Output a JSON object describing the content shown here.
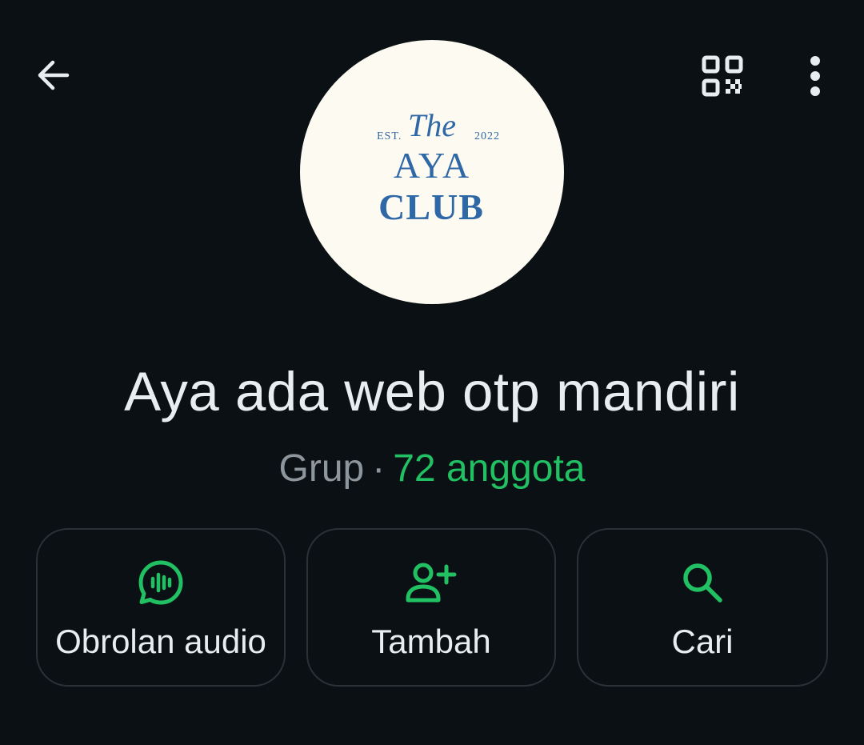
{
  "header": {
    "back_icon": "arrow-left-icon",
    "qr_icon": "qr-code-icon",
    "menu_icon": "more-vertical-icon"
  },
  "avatar": {
    "est": "EST.",
    "script_word": "The",
    "year": "2022",
    "line1": "AYA",
    "line2": "CLUB",
    "text_color": "#2f68a6",
    "background": "#fcfaf1"
  },
  "group": {
    "name": "Aya ada web otp mandiri",
    "type": "Grup",
    "separator": "·",
    "members": "72 anggota"
  },
  "actions": [
    {
      "label": "Obrolan audio",
      "icon": "audio-chat-icon"
    },
    {
      "label": "Tambah",
      "icon": "add-person-icon"
    },
    {
      "label": "Cari",
      "icon": "search-icon"
    }
  ],
  "colors": {
    "background": "#0b1014",
    "accent": "#21c063",
    "text_primary": "#e9edef",
    "text_secondary": "#8d969c",
    "border": "#2a3238"
  }
}
